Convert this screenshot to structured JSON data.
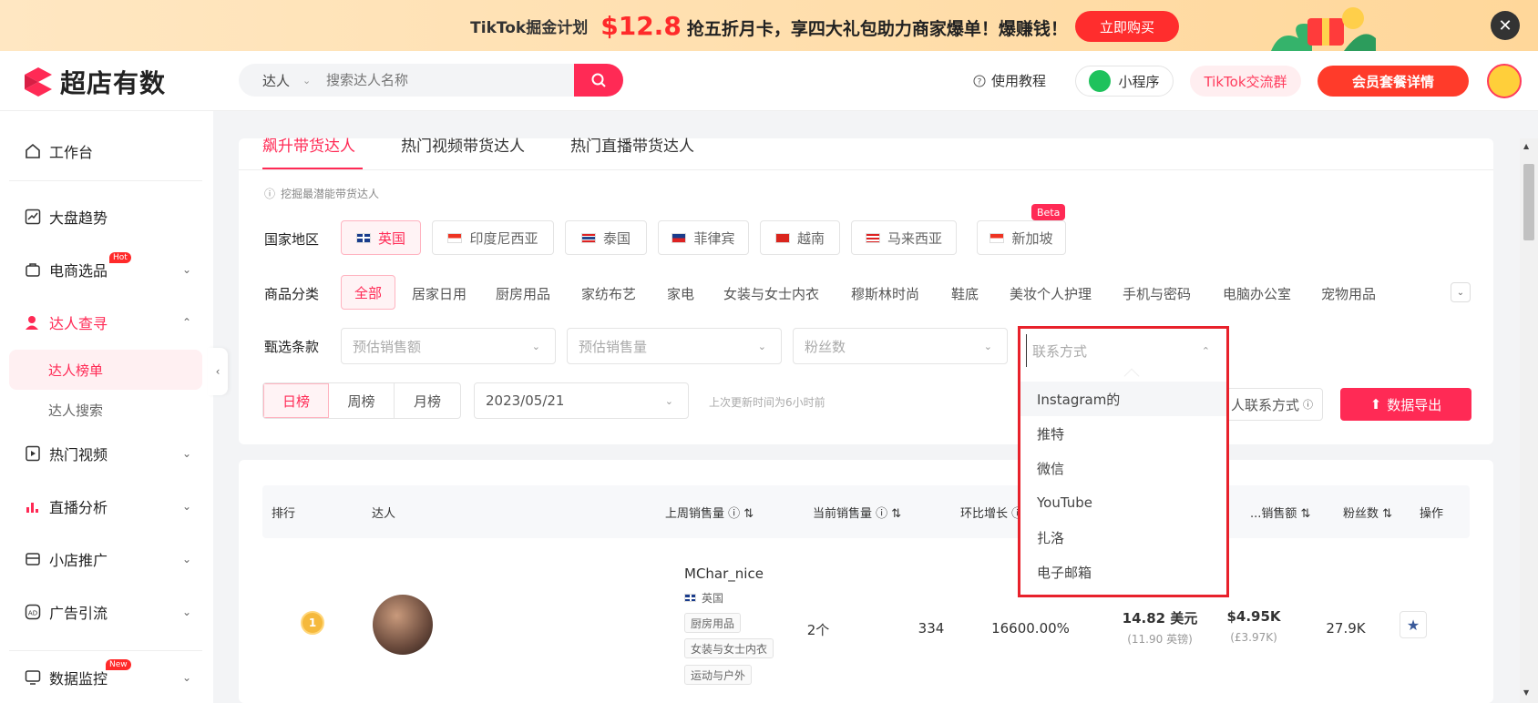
{
  "banner": {
    "prefix": "TikTok掘金计划",
    "price": "$12.8",
    "text": "抢五折月卡，享四大礼包助力商家爆单！爆赚钱！",
    "button": "立即购买"
  },
  "header": {
    "logo": "超店有数",
    "search_type": "达人",
    "search_placeholder": "搜索达人名称",
    "tutorial": "使用教程",
    "mini_program": "小程序",
    "tiktok_group": "TikTok交流群",
    "vip": "会员套餐详情"
  },
  "sidebar": {
    "workbench": "工作台",
    "market_trend": "大盘趋势",
    "ecommerce": "电商选品",
    "hot_badge": "Hot",
    "influencer_query": "达人查寻",
    "influencer_rank": "达人榜单",
    "influencer_search": "达人搜索",
    "hot_video": "热门视频",
    "live_analysis": "直播分析",
    "shop_promo": "小店推广",
    "ad_guide": "广告引流",
    "data_monitor": "数据监控",
    "new_badge": "New"
  },
  "tabs": [
    "飙升带货达人",
    "热门视频带货达人",
    "热门直播带货达人"
  ],
  "hint": "挖掘最潜能带货达人",
  "country": {
    "label": "国家地区",
    "beta": "Beta",
    "items": [
      "英国",
      "印度尼西亚",
      "泰国",
      "菲律宾",
      "越南",
      "马来西亚",
      "新加坡"
    ]
  },
  "category": {
    "label": "商品分类",
    "items": [
      "全部",
      "居家日用",
      "厨房用品",
      "家纺布艺",
      "家电",
      "女装与女士内衣",
      "穆斯林时尚",
      "鞋底",
      "美妆个人护理",
      "手机与密码",
      "电脑办公室",
      "宠物用品"
    ]
  },
  "filter": {
    "label": "甄选条款",
    "selects": [
      "预估销售额",
      "预估销售量",
      "粉丝数",
      "联系方式"
    ]
  },
  "period": {
    "items": [
      "日榜",
      "周榜",
      "月榜"
    ],
    "date": "2023/05/21",
    "update_hint": "上次更新时间为6小时前",
    "contact_btn": "人联系方式",
    "export_btn": "数据导出"
  },
  "dropdown": {
    "options": [
      "Instagram的",
      "推特",
      "微信",
      "YouTube",
      "扎洛",
      "电子邮箱"
    ]
  },
  "table": {
    "headers": [
      "排行",
      "达人",
      "上周销售量",
      "当前销售量",
      "环比增长",
      "销售额",
      "粉丝数",
      "操作"
    ],
    "row": {
      "rank": "1",
      "name": "MChar_nice",
      "country": "英国",
      "tags": [
        "厨房用品",
        "女装与女士内衣",
        "运动与户外"
      ],
      "last_week": "2个",
      "current": "334",
      "growth": "16600.00%",
      "price": "14.82 美元",
      "price_sub": "(11.90 英镑)",
      "sales": "$4.95K",
      "sales_sub": "(£3.97K)",
      "fans": "27.9K"
    }
  }
}
